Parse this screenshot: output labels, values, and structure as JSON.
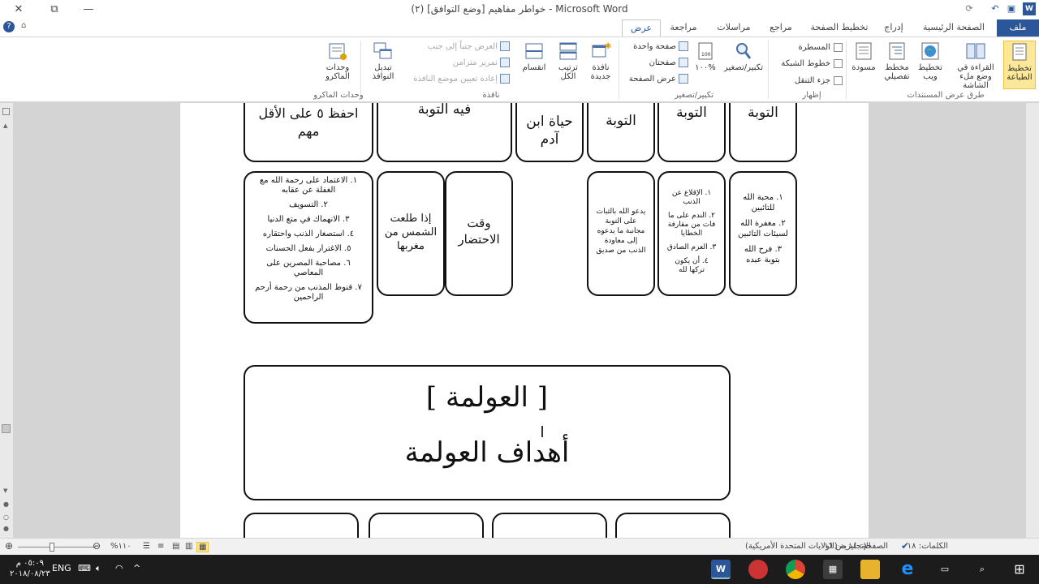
{
  "window": {
    "title": "(٢) خواطر مفاهيم [وضع التوافق] - Microsoft Word",
    "close_glyph": "✕",
    "restore_glyph": "⧉",
    "minimize_glyph": "—",
    "help_glyph": "?"
  },
  "tabs": {
    "file": "ملف",
    "home": "الصفحة الرئيسية",
    "insert": "إدراج",
    "layout": "تخطيط الصفحة",
    "references": "مراجع",
    "mailings": "مراسلات",
    "review": "مراجعة",
    "view": "عرض"
  },
  "ribbon": {
    "views": {
      "print_layout": "تخطيط الطباعة",
      "read_mode": "القراءة في وضع ملء الشاشة",
      "web_layout": "تخطيط ويب",
      "outline": "مخطط تفصيلي",
      "draft": "مسودة",
      "group": "طرق عرض المستندات"
    },
    "show": {
      "ruler": "المسطرة",
      "gridlines": "خطوط الشبكة",
      "nav_pane": "جزء التنقل",
      "group": "إظهار"
    },
    "zoom": {
      "zoom": "تكبير/تصغير",
      "hundred": "١٠٠%",
      "one_page": "صفحة واحدة",
      "two_pages": "صفحتان",
      "page_width": "عرض الصفحة",
      "group": "تكبير/تصغير"
    },
    "window": {
      "new_window": "نافذة جديدة",
      "arrange_all": "ترتيب الكل",
      "split": "انقسام",
      "side_by_side": "العرض جنباً إلى جنب",
      "sync_scroll": "تمرير متزامن",
      "reset_pos": "إعادة تعيين موضع النافذة",
      "switch": "تبديل النوافذ",
      "group": "نافذة"
    },
    "macros": {
      "macros": "وحدات الماكرو",
      "group": "وحدات الماكرو"
    }
  },
  "doc": {
    "top_row": {
      "c1": "التوبة",
      "c2": "التوبة",
      "c3": "التوبة",
      "c4": "حياة ابن آدم",
      "c5": "فيه التوبة",
      "c6": "احفظ ٥ على الأقل مهم"
    },
    "mid_row": {
      "love": [
        "١. محبة الله للتائبين",
        "٢. مغفرة الله لسيئات التائبين",
        "٣. فرح الله بتوبة عبده"
      ],
      "conditions": [
        "١. الإقلاع عن الذنب",
        "٢. الندم على ما فات من مقارفة الخطايا",
        "٣. العزم الصادق",
        "٤. أن يكون تركها لله"
      ],
      "supports": "يدعو الله بالثبات على التوبة مجانبة ما يدعوه إلى معاودة الذنب من صديق",
      "death": "وقت الاحتضار",
      "sun": "إذا طلعت الشمس من مغربها",
      "obstacles": [
        "١. الاعتماد على رحمة الله مع الغفلة عن عقابه",
        "٢. التسويف",
        "٣. الانهماك في متع الدنيا",
        "٤. استصغار الذنب واحتقاره",
        "٥. الاغترار بفعل الحسنات",
        "٦. مصاحبة المصرين على المعاصي",
        "٧. قنوط المذنب من رحمة أرحم الراحمين"
      ]
    },
    "globalization": {
      "title": "[ العولمة ]",
      "subtitle": "أهداف العولمة"
    }
  },
  "status": {
    "page": "الصفحة: ١٤ من ١٦",
    "words": "الكلمات: ١٨",
    "language": "الإنجليزية (الولايات المتحدة الأمريكية)",
    "zoom": "%١١٠"
  },
  "taskbar": {
    "time": "٠٥:٠٩ م",
    "date": "٢٠١٨/٠٨/٢٣",
    "lang": "ENG"
  },
  "colors": {
    "brand": "#2b579a",
    "taskbar": "#1c1c1c"
  }
}
